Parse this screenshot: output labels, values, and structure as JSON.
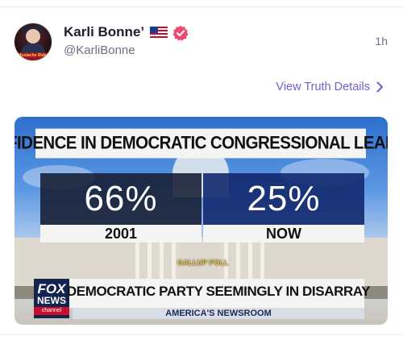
{
  "post": {
    "display_name": "Karli Bonne’",
    "handle": "@KarliBonne",
    "time_ago": "1h",
    "flag_icon": "us-flag-icon",
    "verified_icon": "verified-badge-icon",
    "verified_color": "#f0486f",
    "details_link": "View Truth Details",
    "details_chevron_icon": "chevron-right-icon",
    "accent_color": "#6f5fd3"
  },
  "avatar": {
    "caption": "Mustache Rider"
  },
  "media": {
    "banner_title": "CONFIDENCE IN DEMOCRATIC CONGRESSIONAL LEADERS",
    "stats": [
      {
        "value": "66%",
        "label": "2001"
      },
      {
        "value": "25%",
        "label": "NOW"
      }
    ],
    "source": "GALLUP POLL",
    "network_logo": {
      "line1": "FOX",
      "line2": "NEWS",
      "line3": "channel"
    },
    "headline": "DEMOCRATIC PARTY SEEMINGLY IN DISARRAY",
    "show_name": "AMERICA'S NEWSROOM"
  }
}
